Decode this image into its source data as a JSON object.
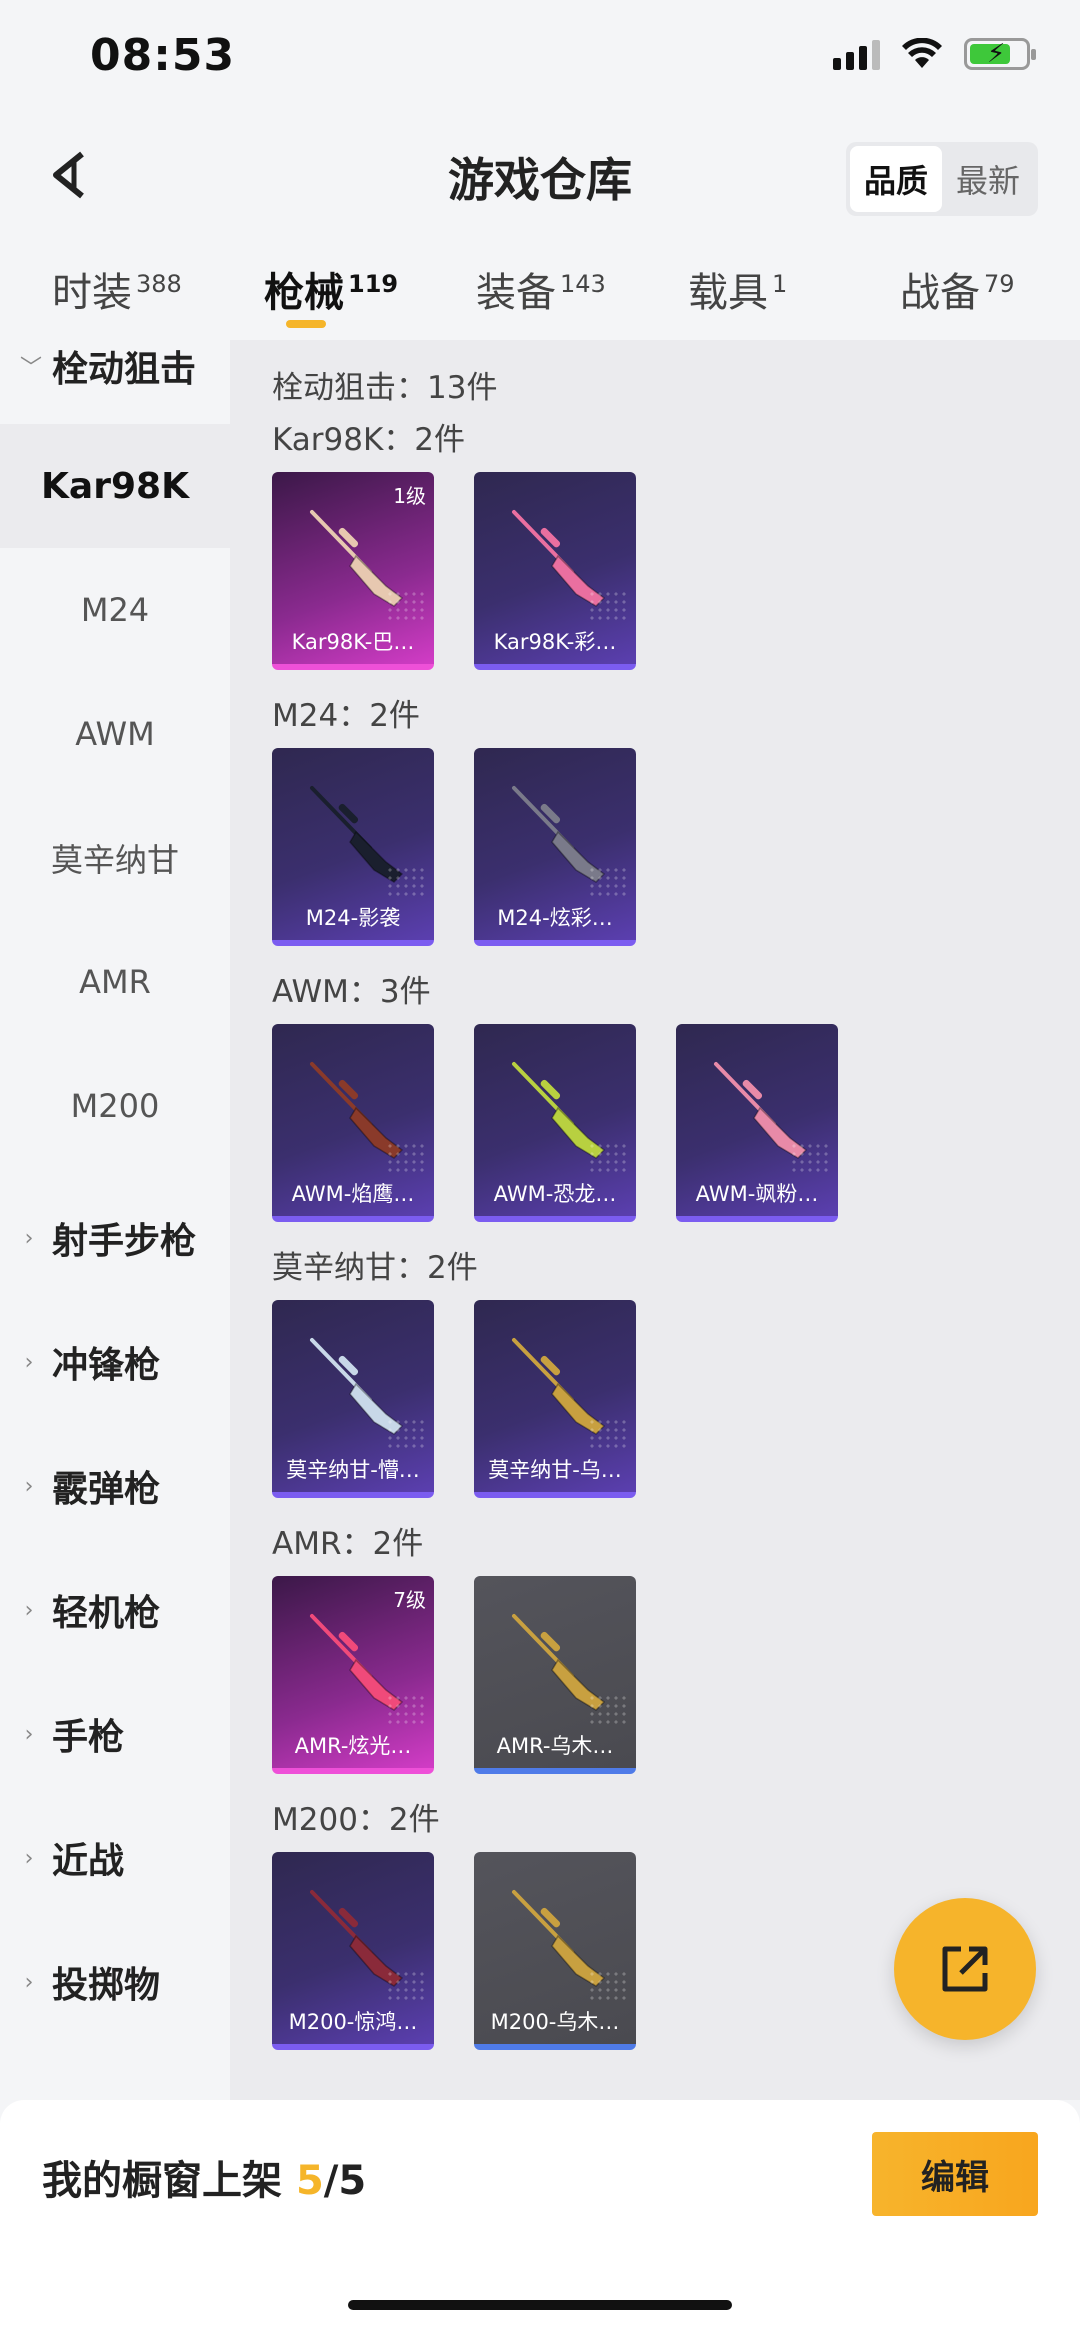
{
  "status_bar": {
    "time": "08:53"
  },
  "header": {
    "title": "游戏仓库",
    "sort_options": [
      "品质",
      "最新"
    ],
    "sort_active": "品质"
  },
  "tabs": [
    {
      "label": "时装",
      "count": "388"
    },
    {
      "label": "枪械",
      "count": "119"
    },
    {
      "label": "装备",
      "count": "143"
    },
    {
      "label": "载具",
      "count": "1"
    },
    {
      "label": "战备",
      "count": "79"
    }
  ],
  "active_tab": "枪械",
  "sidebar": {
    "expanded_group": "栓动狙击",
    "sub_items": [
      "Kar98K",
      "M24",
      "AWM",
      "莫辛纳甘",
      "AMR",
      "M200"
    ],
    "active_sub_item": "Kar98K",
    "groups": [
      "射手步枪",
      "冲锋枪",
      "霰弹枪",
      "轻机枪",
      "手枪",
      "近战",
      "投掷物"
    ]
  },
  "content": {
    "category_summary": "栓动狙击：13件",
    "sections": [
      {
        "title": "Kar98K：2件",
        "items": [
          {
            "name": "Kar98K-巴…",
            "rarity": "pink",
            "level": "1级",
            "gun_color": "#e7c8b0"
          },
          {
            "name": "Kar98K-彩…",
            "rarity": "purple",
            "level": "",
            "gun_color": "#ea6fa0"
          }
        ]
      },
      {
        "title": "M24：2件",
        "items": [
          {
            "name": "M24-影袭",
            "rarity": "purple",
            "level": "",
            "gun_color": "#1a1f2e"
          },
          {
            "name": "M24-炫彩…",
            "rarity": "purple",
            "level": "",
            "gun_color": "#7a7a8a"
          }
        ]
      },
      {
        "title": "AWM：3件",
        "items": [
          {
            "name": "AWM-焰鹰…",
            "rarity": "purple",
            "level": "",
            "gun_color": "#8a3a2a"
          },
          {
            "name": "AWM-恐龙…",
            "rarity": "purple",
            "level": "",
            "gun_color": "#b8d040"
          },
          {
            "name": "AWM-飒粉…",
            "rarity": "purple",
            "level": "",
            "gun_color": "#e88aa8"
          }
        ]
      },
      {
        "title": "莫辛纳甘：2件",
        "items": [
          {
            "name": "莫辛纳甘-懵…",
            "rarity": "purple",
            "level": "",
            "gun_color": "#c8d8e8"
          },
          {
            "name": "莫辛纳甘-乌…",
            "rarity": "purple",
            "level": "",
            "gun_color": "#c8a040"
          }
        ]
      },
      {
        "title": "AMR：2件",
        "items": [
          {
            "name": "AMR-炫光…",
            "rarity": "pink",
            "level": "7级",
            "gun_color": "#f04a7a"
          },
          {
            "name": "AMR-乌木…",
            "rarity": "gray",
            "level": "",
            "gun_color": "#c8a040"
          }
        ]
      },
      {
        "title": "M200：2件",
        "items": [
          {
            "name": "M200-惊鸿…",
            "rarity": "purple",
            "level": "",
            "gun_color": "#8a2a3a"
          },
          {
            "name": "M200-乌木…",
            "rarity": "gray",
            "level": "",
            "gun_color": "#c8a040"
          }
        ]
      }
    ]
  },
  "bottom_bar": {
    "label": "我的橱窗上架",
    "current": "5",
    "separator_total": "/5",
    "edit_label": "编辑"
  },
  "icons": {
    "back": "back-arrow-icon",
    "share": "share-external-icon",
    "expand": "chevron-down-icon",
    "collapse": "chevron-right-icon"
  },
  "colors": {
    "accent": "#f5b52a",
    "rarity_purple": "#7b5cf0",
    "rarity_pink": "#ee50d8",
    "rarity_gray_bar": "#4f7be8"
  }
}
